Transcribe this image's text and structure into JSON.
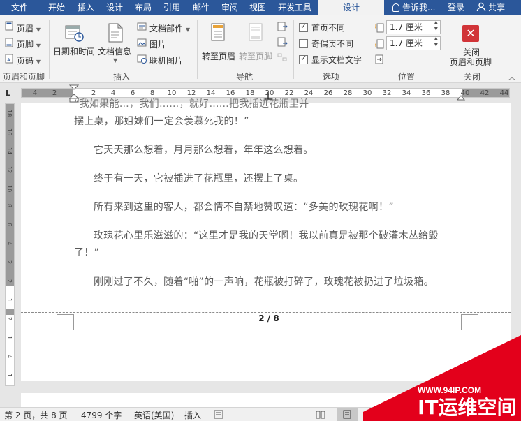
{
  "menu": {
    "file": "文件",
    "home": "开始",
    "insert": "插入",
    "design": "设计",
    "layout": "布局",
    "references": "引用",
    "mailings": "邮件",
    "review": "审阅",
    "view": "视图",
    "developer": "开发工具",
    "active_tab": "设计",
    "tell_me": "告诉我...",
    "login": "登录",
    "share": "共享"
  },
  "ribbon": {
    "header": "页眉",
    "footer": "页脚",
    "page_number": "页码",
    "group_header_footer": "页眉和页脚",
    "date_time": "日期和时间",
    "doc_info": "文档信息",
    "doc_parts": "文档部件",
    "picture": "图片",
    "online_picture": "联机图片",
    "group_insert": "插入",
    "goto_header": "转至页眉",
    "goto_footer": "转至页脚",
    "group_navigation": "导航",
    "diff_first_page": "首页不同",
    "diff_odd_even": "奇偶页不同",
    "show_doc_text": "显示文档文字",
    "group_options": "选项",
    "header_pos": "1.7 厘米",
    "footer_pos": "1.7 厘米",
    "group_position": "位置",
    "close_line1": "关闭",
    "close_line2": "页眉和页脚",
    "group_close": "关闭",
    "options_checked": {
      "diff_first_page": true,
      "diff_odd_even": false,
      "show_doc_text": true
    }
  },
  "ruler": {
    "left_numbers": [
      "4",
      "2"
    ],
    "numbers": [
      "2",
      "4",
      "6",
      "8",
      "10",
      "12",
      "14",
      "16",
      "18",
      "20",
      "22",
      "24",
      "26",
      "28",
      "30",
      "32",
      "34",
      "36",
      "38",
      "40",
      "42",
      "44"
    ]
  },
  "vruler": {
    "numbers": [
      "18",
      "16",
      "14",
      "12",
      "10",
      "8",
      "6",
      "4",
      "2",
      "2",
      "1",
      "2",
      "1",
      "4",
      "1"
    ]
  },
  "document": {
    "line1_partial": "“我如果能…，我们……，就好……把我插进花瓶里并",
    "line1": "摆上桌，那姐妹们一定会羡慕死我的！”",
    "para2": "它天天那么想着，月月那么想着，年年这么想着。",
    "para3": "终于有一天，它被插进了花瓶里，还摆上了桌。",
    "para4": "所有来到这里的客人，都会情不自禁地赞叹道：“多美的玫瑰花啊！”",
    "para5_line1": "玫瑰花心里乐滋滋的：“这里才是我的天堂啊！我以前真是被那个破灌木丛给毁",
    "para5_line2": "了！”",
    "para6": "刚刚过了不久，随着“啪”的一声响，花瓶被打碎了，玫瑰花被扔进了垃圾箱。",
    "page_number": "2 / 8"
  },
  "status": {
    "page": "第 2 页，共 8 页",
    "words": "4799 个字",
    "language": "英语(美国)",
    "insert_mode": "插入"
  },
  "watermark": {
    "url": "WWW.94IP.COM",
    "brand": "IT运维空间"
  },
  "colors": {
    "title_bar": "#2b579a",
    "close_icon": "#d13438",
    "watermark_red": "#e3001b"
  }
}
